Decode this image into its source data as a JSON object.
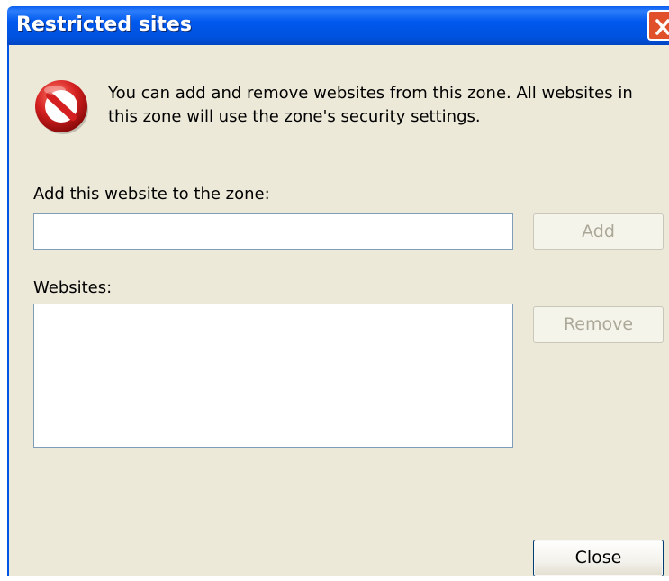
{
  "window": {
    "title": "Restricted sites",
    "close_icon": "x-icon"
  },
  "info": {
    "icon": "no-entry-icon",
    "text": "You can add and remove websites from this zone. All websites in\nthis zone will use the zone's security settings."
  },
  "add_section": {
    "label": "Add this website to the zone:",
    "input_value": "",
    "add_button": "Add"
  },
  "websites_section": {
    "label": "Websites:",
    "items": [],
    "remove_button": "Remove"
  },
  "footer": {
    "close_button": "Close"
  },
  "colors": {
    "titlebar": "#0054e3",
    "dialog_bg": "#ece9d8",
    "close_red": "#e0502a"
  }
}
